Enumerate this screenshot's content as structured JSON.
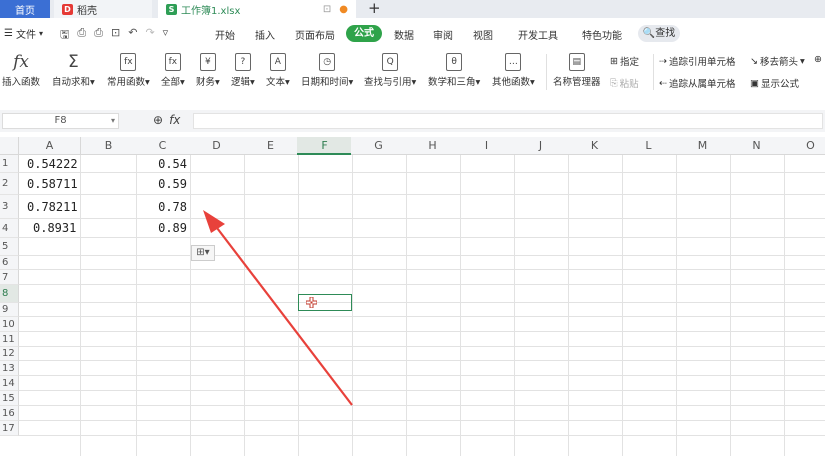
{
  "tabs": {
    "home": "首页",
    "daoke": "稻壳",
    "workbook": "工作簿1.xlsx",
    "new_tab": "+"
  },
  "menu": {
    "file": "文件",
    "items": [
      "开始",
      "插入",
      "页面布局",
      "公式",
      "数据",
      "审阅",
      "视图",
      "开发工具",
      "特色功能"
    ],
    "active": "公式",
    "search": "查找"
  },
  "ribbon": {
    "buttons": [
      {
        "label": "插入函数",
        "icon": "fx-icon"
      },
      {
        "label": "自动求和",
        "icon": "sigma-icon"
      },
      {
        "label": "常用函数",
        "icon": "function-icon"
      },
      {
        "label": "全部",
        "icon": "function-icon"
      },
      {
        "label": "财务",
        "icon": "finance-icon"
      },
      {
        "label": "逻辑",
        "icon": "logic-icon"
      },
      {
        "label": "文本",
        "icon": "text-icon"
      },
      {
        "label": "日期和时间",
        "icon": "clock-icon"
      },
      {
        "label": "查找与引用",
        "icon": "lookup-icon"
      },
      {
        "label": "数学和三角",
        "icon": "math-icon"
      },
      {
        "label": "其他函数",
        "icon": "more-icon"
      },
      {
        "label": "名称管理器",
        "icon": "name-manager-icon"
      }
    ],
    "small": {
      "assign": "指定",
      "paste": "粘贴",
      "trace_precedents": "追踪引用单元格",
      "trace_dependents": "追踪从属单元格",
      "remove_arrows": "移去箭头",
      "show_formulas": "显示公式"
    }
  },
  "formula_bar": {
    "name_box": "F8",
    "fx": "fx",
    "content": ""
  },
  "grid": {
    "columns": [
      "A",
      "B",
      "C",
      "D",
      "E",
      "F",
      "G",
      "H",
      "I",
      "J",
      "K",
      "L",
      "M",
      "N",
      "O"
    ],
    "selected_column": "F",
    "rows": [
      "1",
      "2",
      "3",
      "4",
      "5",
      "6",
      "7",
      "8",
      "9",
      "10",
      "11",
      "12",
      "13",
      "14",
      "15",
      "16",
      "17"
    ],
    "selected_row": "8",
    "cells": {
      "A1": "0.54222",
      "A2": "0.58711",
      "A3": "0.78211",
      "A4": "0.8931",
      "C1": "0.54",
      "C2": "0.59",
      "C3": "0.78",
      "C4": "0.89"
    }
  },
  "colors": {
    "accent": "#2fa34a",
    "tab_blue": "#3b6fd4",
    "selection": "#2e8b57",
    "arrow": "#e8413b"
  }
}
